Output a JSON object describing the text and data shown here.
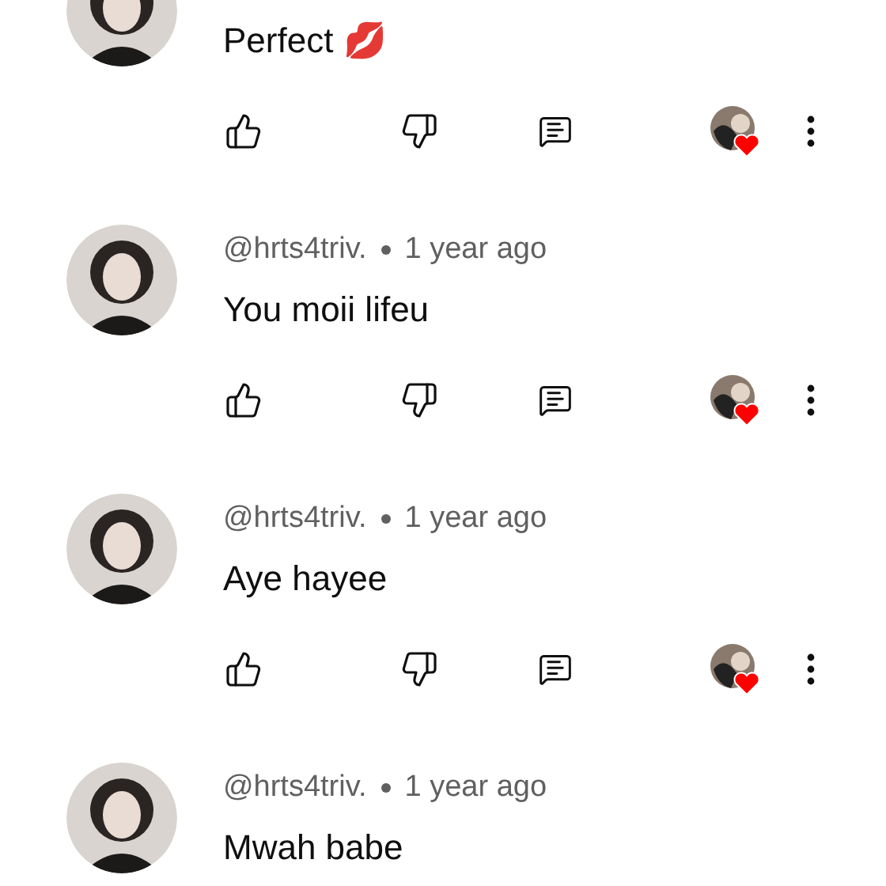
{
  "comments": [
    {
      "text": "Perfect 💋",
      "hearted": true
    },
    {
      "author": "@hrts4triv.",
      "time": "1 year ago",
      "text": "You moii lifeu",
      "hearted": true
    },
    {
      "author": "@hrts4triv.",
      "time": "1 year ago",
      "text": "Aye hayee",
      "hearted": true
    },
    {
      "author": "@hrts4triv.",
      "time": "1 year ago",
      "text": "Mwah babe"
    }
  ]
}
